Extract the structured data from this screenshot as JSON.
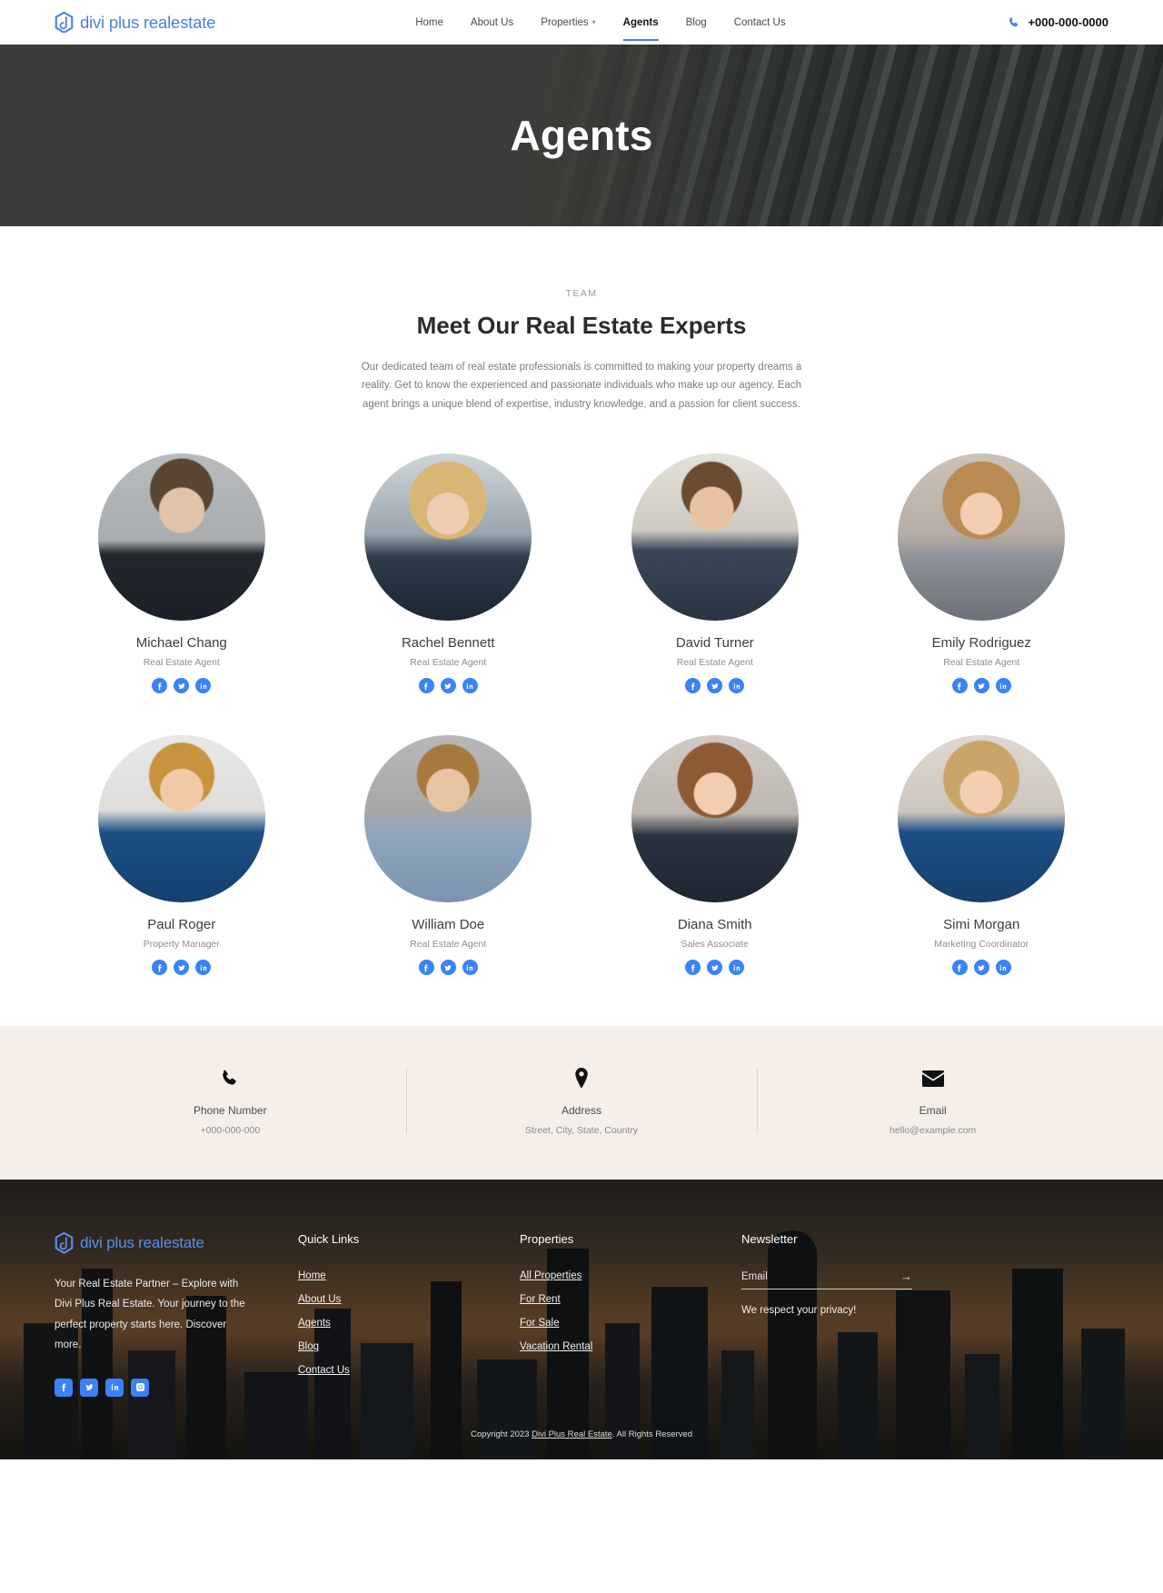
{
  "header": {
    "logo_text": "divi plus realestate",
    "logo_icon": "divi-plus-logo-icon",
    "nav": [
      {
        "label": "Home",
        "active": false,
        "has_caret": false
      },
      {
        "label": "About Us",
        "active": false,
        "has_caret": false
      },
      {
        "label": "Properties",
        "active": false,
        "has_caret": true
      },
      {
        "label": "Agents",
        "active": true,
        "has_caret": false
      },
      {
        "label": "Blog",
        "active": false,
        "has_caret": false
      },
      {
        "label": "Contact Us",
        "active": false,
        "has_caret": false
      }
    ],
    "phone": "+000-000-0000",
    "phone_icon": "phone-icon"
  },
  "hero": {
    "title": "Agents"
  },
  "team": {
    "eyebrow": "TEAM",
    "title": "Meet Our Real Estate Experts",
    "description": "Our dedicated team of real estate professionals is committed to making your property dreams a reality. Get to know the experienced and passionate individuals who make up our agency. Each agent brings a unique blend of expertise, industry knowledge, and a passion for client success.",
    "social_icons": [
      "facebook-icon",
      "twitter-icon",
      "linkedin-icon"
    ],
    "agents": [
      {
        "name": "Michael Chang",
        "role": "Real Estate Agent"
      },
      {
        "name": "Rachel Bennett",
        "role": "Real Estate Agent"
      },
      {
        "name": "David Turner",
        "role": "Real Estate Agent"
      },
      {
        "name": "Emily Rodriguez",
        "role": "Real Estate Agent"
      },
      {
        "name": "Paul Roger",
        "role": "Property Manager"
      },
      {
        "name": "William Doe",
        "role": "Real Estate Agent"
      },
      {
        "name": "Diana Smith",
        "role": "Sales Associate"
      },
      {
        "name": "Simi Morgan",
        "role": "Marketing Coordinator"
      }
    ]
  },
  "contact": {
    "items": [
      {
        "icon": "phone-icon",
        "label": "Phone Number",
        "value": "+000-000-000"
      },
      {
        "icon": "location-pin-icon",
        "label": "Address",
        "value": "Street, City, State, Country"
      },
      {
        "icon": "envelope-icon",
        "label": "Email",
        "value": "hello@example.com"
      }
    ]
  },
  "footer": {
    "logo_text": "divi plus realestate",
    "description": "Your Real Estate Partner – Explore with Divi Plus Real Estate. Your journey to the perfect property starts here. Discover more.",
    "socials": [
      "facebook-icon",
      "twitter-icon",
      "linkedin-icon",
      "instagram-icon"
    ],
    "quick_links": {
      "heading": "Quick Links",
      "links": [
        "Home",
        "About Us",
        "Agents",
        "Blog",
        "Contact Us"
      ]
    },
    "properties": {
      "heading": "Properties",
      "links": [
        "All Properties",
        "For Rent",
        "For Sale",
        "Vacation Rental"
      ]
    },
    "newsletter": {
      "heading": "Newsletter",
      "placeholder": "Email",
      "value": "",
      "submit_icon": "arrow-right-icon",
      "note": "We respect your privacy!"
    },
    "copyright_prefix": "Copyright 2023 ",
    "copyright_link": "Divi Plus Real Estate",
    "copyright_suffix": ". All Rights Reserved"
  },
  "colors": {
    "brand_blue": "#4a7fe8",
    "social_blue": "#3b82f6",
    "contact_bg": "#f6eee8",
    "hero_overlay": "#4a4845"
  }
}
